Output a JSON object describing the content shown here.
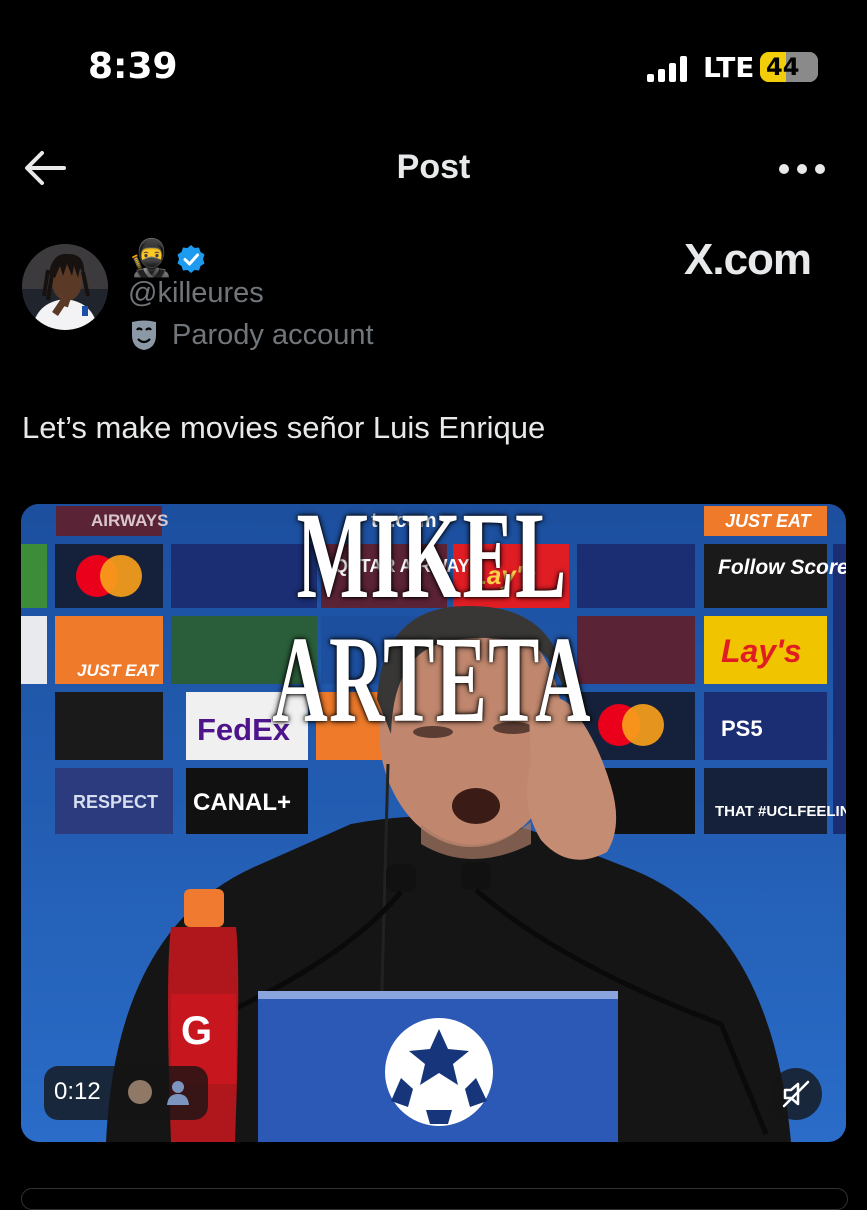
{
  "status_bar": {
    "time": "8:39",
    "network": "LTE",
    "battery": "44",
    "battery_level": 0.44
  },
  "nav": {
    "title": "Post",
    "back_icon": "arrow-left-icon",
    "more_icon": "more-horizontal-icon"
  },
  "author": {
    "display_name_emoji": "🥷",
    "verified": true,
    "handle": "@killeures",
    "label": "Parody account",
    "label_icon": "theater-mask-icon"
  },
  "watermark": "X.com",
  "post": {
    "text": "Let’s make movies señor Luis Enrique"
  },
  "media": {
    "overlay_text": "MIKEL ARTETA",
    "duration": "0:12",
    "muted": true,
    "sponsors": [
      "AIRWAYS",
      "to.com",
      "JUST EAT",
      "Follow Scores",
      "QATAR AIRWAYS",
      "Lay's",
      "JUST EAT",
      "FedEx",
      "PS5",
      "RESPECT",
      "CANAL+",
      "THAT #UCLFEELING"
    ]
  },
  "colors": {
    "background": "#000000",
    "text": "#e7e9ea",
    "secondary_text": "#71767b",
    "verified": "#1d9bf0",
    "backdrop": "#1d5cb4"
  }
}
